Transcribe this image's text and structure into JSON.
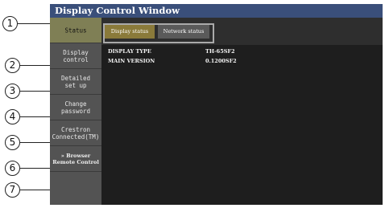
{
  "window": {
    "title": "Display Control Window"
  },
  "sidebar": {
    "items": [
      {
        "label": "Status"
      },
      {
        "label": "Display\ncontrol"
      },
      {
        "label": "Detailed\nset up"
      },
      {
        "label": "Change\npassword"
      },
      {
        "label": "Crestron\nConnected(TM)"
      },
      {
        "label": "» Browser\nRemote Control"
      },
      {
        "label": ""
      }
    ]
  },
  "tabs": [
    {
      "label": "Display status"
    },
    {
      "label": "Network status"
    }
  ],
  "info": [
    {
      "label": "DISPLAY TYPE",
      "value": "TH-65SF2"
    },
    {
      "label": "MAIN VERSION",
      "value": "0.1200SF2"
    }
  ],
  "callouts": [
    "1",
    "2",
    "3",
    "4",
    "5",
    "6",
    "7"
  ]
}
